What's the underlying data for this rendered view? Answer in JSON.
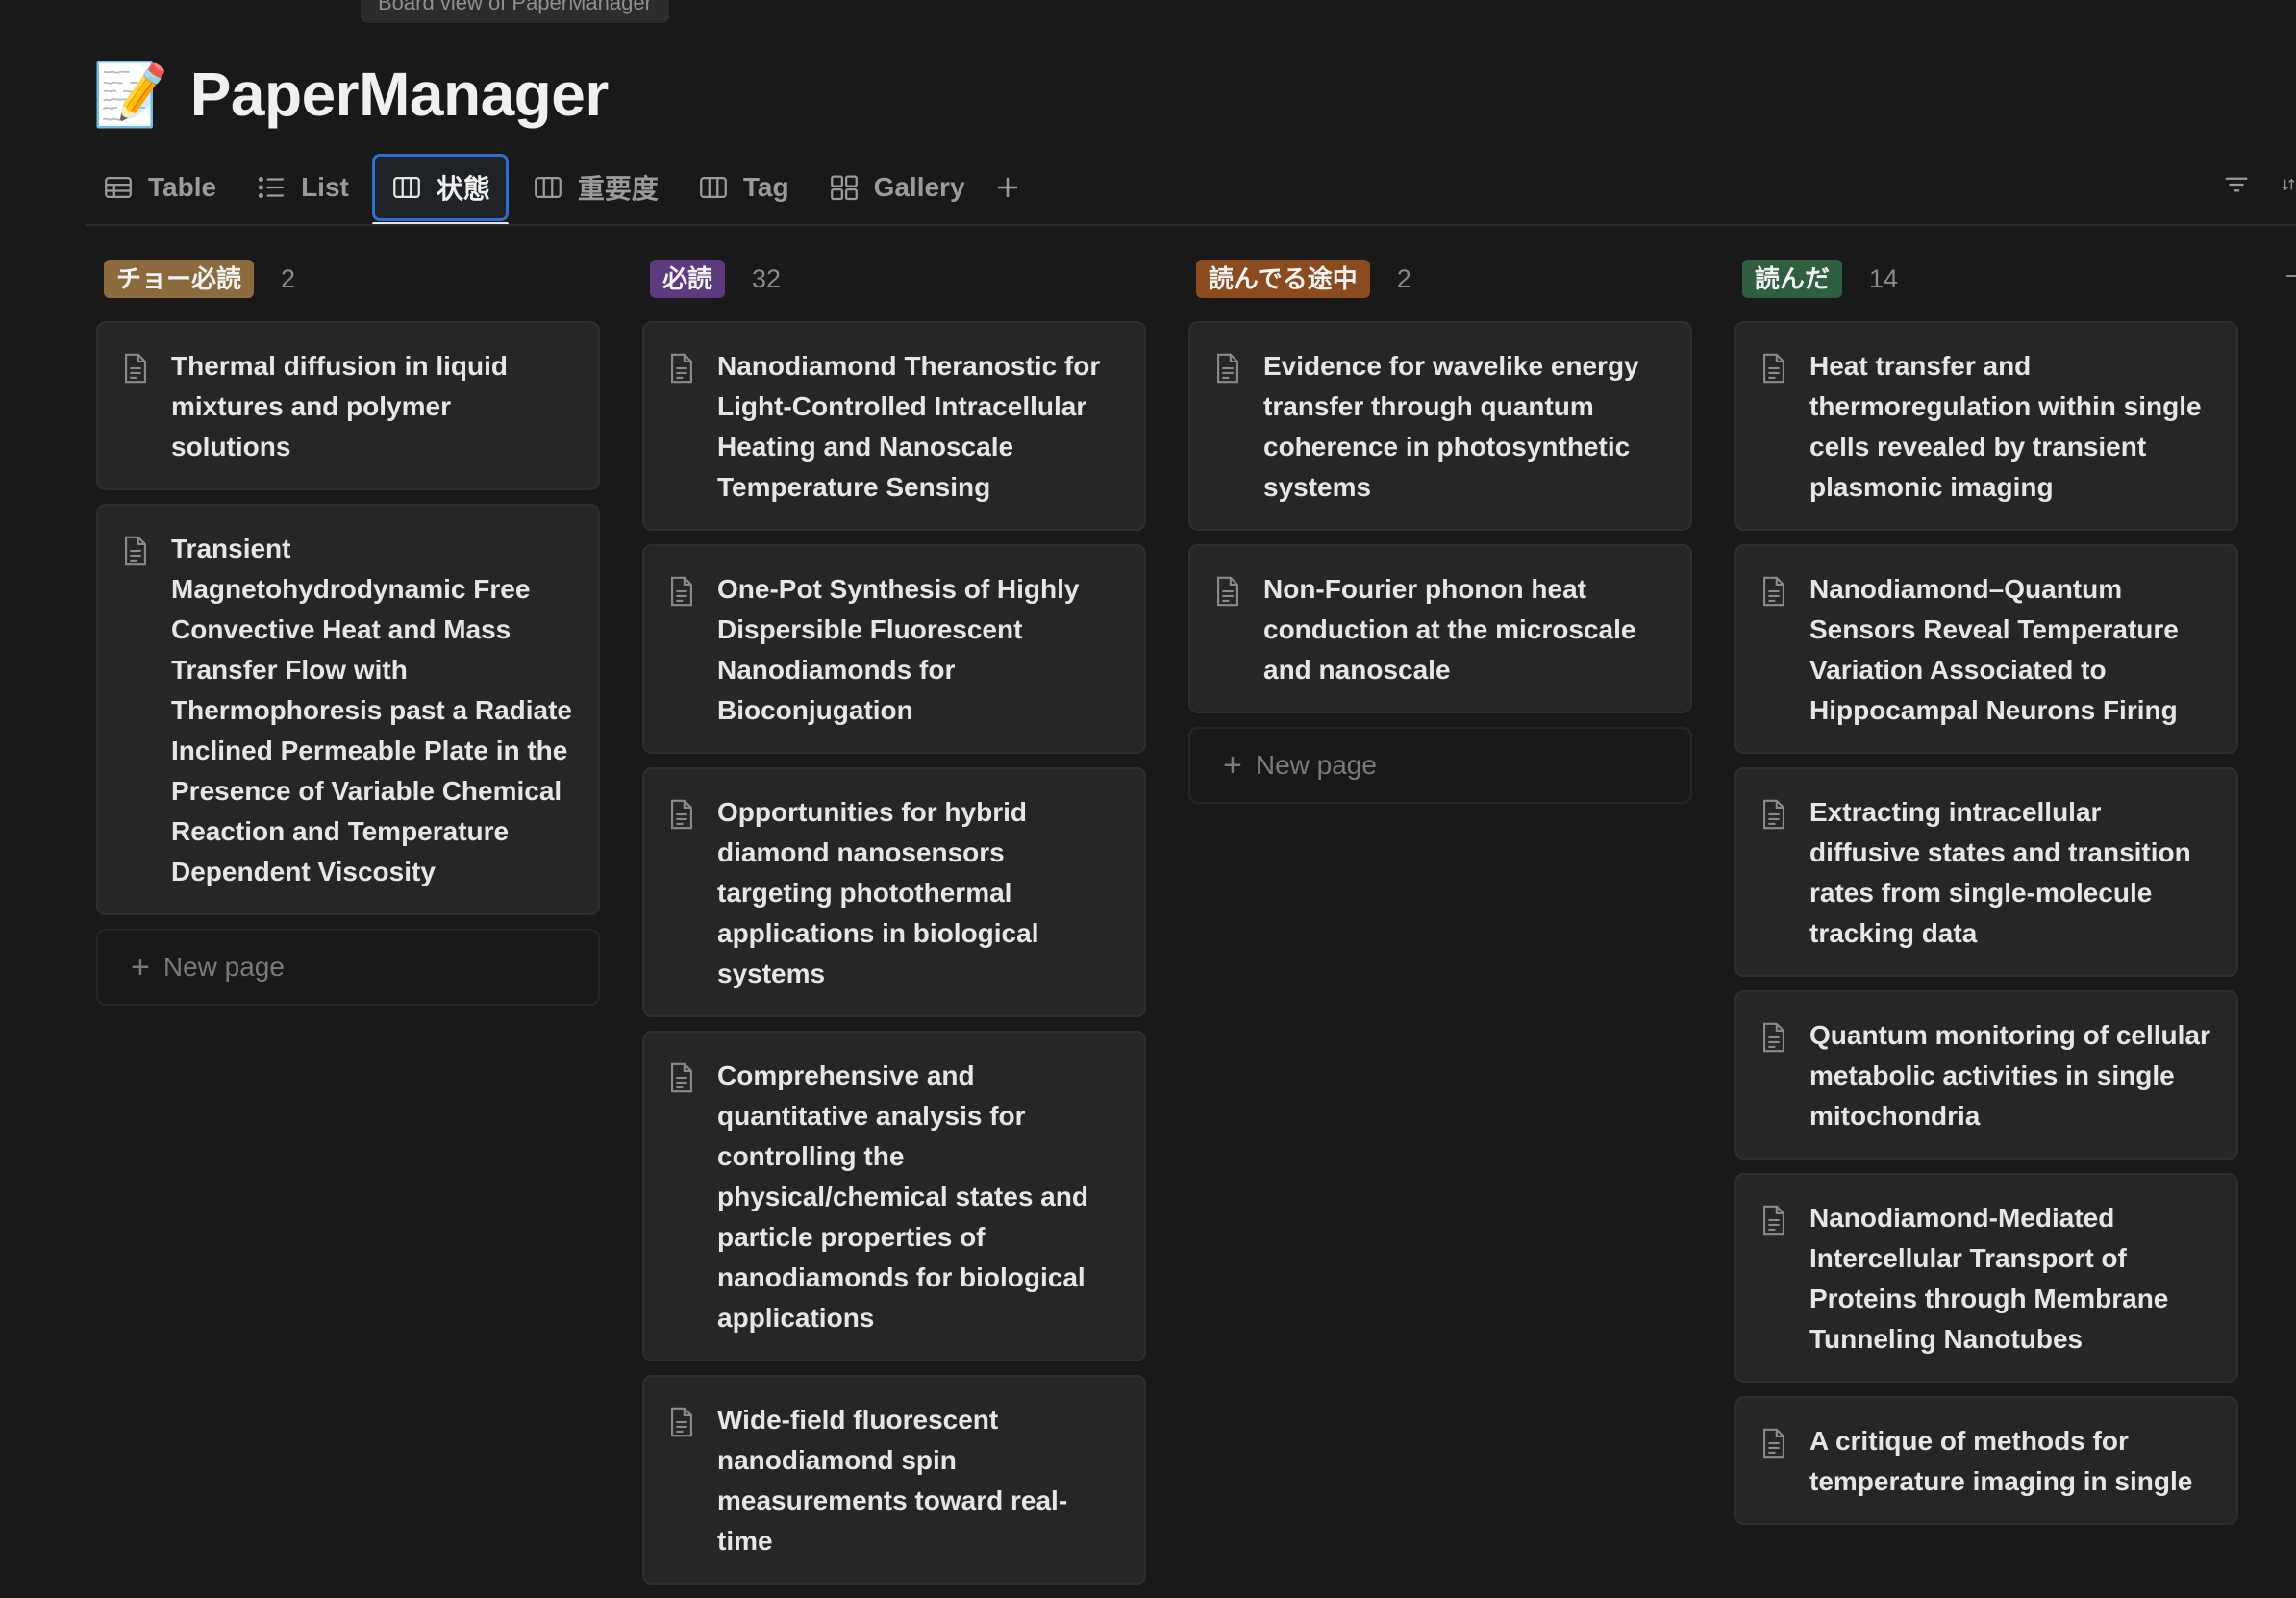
{
  "tooltip": "Board view of PaperManager",
  "page": {
    "icon": "📝",
    "title": "PaperManager"
  },
  "tabs": [
    {
      "label": "Table",
      "icon": "table-icon"
    },
    {
      "label": "List",
      "icon": "list-icon"
    },
    {
      "label": "状態",
      "icon": "board-icon",
      "active": true
    },
    {
      "label": "重要度",
      "icon": "board-icon"
    },
    {
      "label": "Tag",
      "icon": "board-icon"
    },
    {
      "label": "Gallery",
      "icon": "gallery-icon"
    }
  ],
  "toolbar": {
    "icons": [
      "plus-icon",
      "filter-icon",
      "sort-icon"
    ]
  },
  "colors": {
    "accent": "#2f6ecf",
    "background": "#191919",
    "card": "#262626"
  },
  "columns": [
    {
      "status": "チョー必読",
      "count": "2",
      "color": "#8b6b3d",
      "cards": [
        "Thermal diffusion in liquid mixtures and polymer solutions",
        "Transient Magnetohydrodynamic Free Convective Heat and Mass Transfer Flow with Thermophoresis past a Radiate Inclined Permeable Plate in the Presence of Variable Chemical Reaction and Temperature Dependent Viscosity"
      ],
      "new_page": "New page"
    },
    {
      "status": "必読",
      "count": "32",
      "color": "#5b3a7d",
      "cards": [
        "Nanodiamond Theranostic for Light-Controlled Intracellular Heating and Nanoscale Temperature Sensing",
        "One-Pot Synthesis of Highly Dispersible Fluorescent Nanodiamonds for Bioconjugation",
        "Opportunities for hybrid diamond nanosensors targeting photothermal applications in biological systems",
        "Comprehensive and quantitative analysis for controlling the physical/chemical states and particle properties of nanodiamonds for biological applications",
        "Wide-field fluorescent nanodiamond spin measurements toward real-time"
      ]
    },
    {
      "status": "読んでる途中",
      "count": "2",
      "color": "#8a4b1f",
      "cards": [
        "Evidence for wavelike energy transfer through quantum coherence in photosynthetic systems",
        "Non-Fourier phonon heat conduction at the microscale and nanoscale"
      ],
      "new_page": "New page"
    },
    {
      "status": "読んだ",
      "count": "14",
      "color": "#2f5f3e",
      "cards": [
        "Heat transfer and thermoregulation within single cells revealed by transient plasmonic imaging",
        "Nanodiamond–Quantum Sensors Reveal Temperature Variation Associated to Hippocampal Neurons Firing",
        "Extracting intracellular diffusive states and transition rates from single-molecule tracking data",
        "Quantum monitoring of cellular metabolic activities in single mitochondria",
        "Nanodiamond-Mediated Intercellular Transport of Proteins through Membrane Tunneling Nanotubes",
        "A critique of methods for temperature imaging in single"
      ]
    }
  ]
}
